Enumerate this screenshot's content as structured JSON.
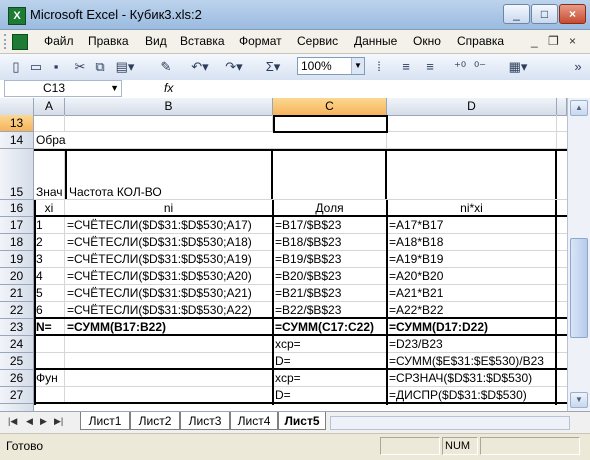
{
  "window": {
    "title": "Microsoft Excel - Кубик3.xls:2"
  },
  "menu": {
    "items": [
      "Файл",
      "Правка",
      "Вид",
      "Вставка",
      "Формат",
      "Сервис",
      "Данные",
      "Окно",
      "Справка"
    ]
  },
  "toolbar": {
    "zoom": "100%",
    "sigma": "Σ"
  },
  "formula_bar": {
    "name_box": "C13",
    "fx": "fx",
    "content": ""
  },
  "columns": [
    "A",
    "B",
    "C",
    "D"
  ],
  "rows": [
    {
      "n": "13",
      "A": "",
      "B": "",
      "C": "",
      "D": ""
    },
    {
      "n": "14",
      "A": "Обра",
      "B": "",
      "C": "",
      "D": ""
    },
    {
      "n": "15",
      "A": "Знач",
      "B": "Частота КОЛ-ВО",
      "C": "",
      "D": ""
    },
    {
      "n": "16",
      "A": "xi",
      "B": "ni",
      "C": "Доля",
      "D": "ni*xi"
    },
    {
      "n": "17",
      "A": "1",
      "B": "=СЧЁТЕСЛИ($D$31:$D$530;A17)",
      "C": "=B17/$B$23",
      "D": "=A17*B17"
    },
    {
      "n": "18",
      "A": "2",
      "B": "=СЧЁТЕСЛИ($D$31:$D$530;A18)",
      "C": "=B18/$B$23",
      "D": "=A18*B18"
    },
    {
      "n": "19",
      "A": "3",
      "B": "=СЧЁТЕСЛИ($D$31:$D$530;A19)",
      "C": "=B19/$B$23",
      "D": "=A19*B19"
    },
    {
      "n": "20",
      "A": "4",
      "B": "=СЧЁТЕСЛИ($D$31:$D$530;A20)",
      "C": "=B20/$B$23",
      "D": "=A20*B20"
    },
    {
      "n": "21",
      "A": "5",
      "B": "=СЧЁТЕСЛИ($D$31:$D$530;A21)",
      "C": "=B21/$B$23",
      "D": "=A21*B21"
    },
    {
      "n": "22",
      "A": "6",
      "B": "=СЧЁТЕСЛИ($D$31:$D$530;A22)",
      "C": "=B22/$B$23",
      "D": "=A22*B22"
    },
    {
      "n": "23",
      "A": "N=",
      "B": "=СУММ(B17:B22)",
      "C": "=СУММ(C17:C22)",
      "D": "=СУММ(D17:D22)"
    },
    {
      "n": "24",
      "A": "",
      "B": "",
      "C": "xср=",
      "D": "=D23/B23"
    },
    {
      "n": "25",
      "A": "",
      "B": "",
      "C": "D=",
      "D": "=СУММ($E$31:$E$530)/B23"
    },
    {
      "n": "26",
      "A": "Фун",
      "B": "",
      "C": "xср=",
      "D": "=СРЗНАЧ($D$31:$D$530)"
    },
    {
      "n": "27",
      "A": "",
      "B": "",
      "C": "D=",
      "D": "=ДИСПР($D$31:$D$530)"
    }
  ],
  "sheets": [
    "Лист1",
    "Лист2",
    "Лист3",
    "Лист4",
    "Лист5"
  ],
  "active_sheet": "Лист5",
  "status": {
    "text": "Готово",
    "num": "NUM"
  }
}
